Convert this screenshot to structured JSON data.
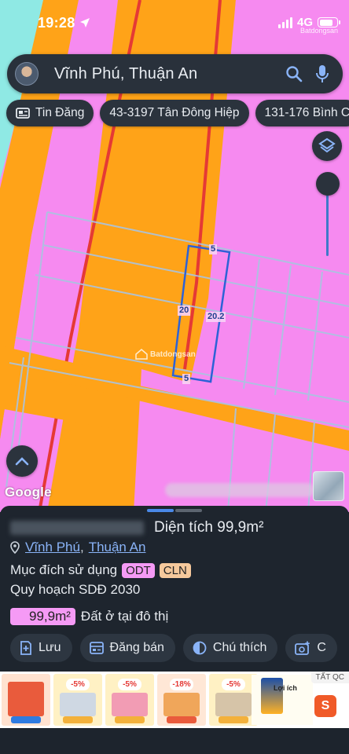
{
  "status_bar": {
    "time": "19:28",
    "network": "4G",
    "watermark": "Batdongsan"
  },
  "search": {
    "query": "Vĩnh Phú, Thuận An"
  },
  "chips": [
    {
      "label": "Tin Đăng",
      "icon": "listing-icon"
    },
    {
      "label": "43-3197 Tân Đông Hiệp"
    },
    {
      "label": "131-176 Bình C"
    }
  ],
  "map": {
    "colors": {
      "land_residential": "#f68af0",
      "road": "#ffa318",
      "road_edge": "#e53935",
      "water": "#8fe9e4"
    },
    "parcel_dimensions": {
      "top": "5",
      "left": "20",
      "right": "20.2",
      "bottom": "5"
    },
    "watermark": "Batdongsan",
    "attribution": "Google"
  },
  "panel": {
    "title": "Diện tích 99,9m²",
    "location": {
      "ward": "Vĩnh Phú",
      "district": "Thuận An",
      "separator": ","
    },
    "purpose": {
      "label": "Mục đích sử dụng",
      "tags": [
        {
          "code": "ODT",
          "color": "#f59af5"
        },
        {
          "code": "CLN",
          "color": "#f6c99c"
        }
      ]
    },
    "planning_label": "Quy hoạch SDĐ 2030",
    "land_use": {
      "area": "99,9m²",
      "description": "Đất ở tại đô thị",
      "color": "#f59af5"
    },
    "actions": [
      {
        "label": "Lưu",
        "icon": "bookmark-add-icon"
      },
      {
        "label": "Đăng bán",
        "icon": "post-sale-icon"
      },
      {
        "label": "Chú thích",
        "icon": "contrast-icon"
      },
      {
        "label": "C",
        "icon": "add-photo-icon"
      }
    ]
  },
  "ad": {
    "close_label": "TẤT QC",
    "discounts": [
      "-5%",
      "-5%",
      "-18%",
      "-5%"
    ],
    "featured_title": "Lợi ích"
  }
}
